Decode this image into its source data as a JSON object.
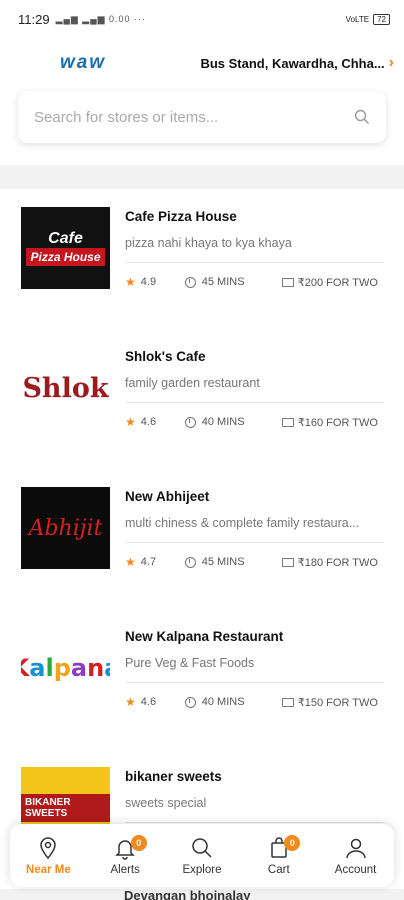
{
  "status_bar": {
    "time": "11:29",
    "signal": "0.00",
    "network": "VoLTE",
    "battery": "72"
  },
  "header": {
    "logo": "waw",
    "location": "Bus Stand, Kawardha, Chha..."
  },
  "search": {
    "placeholder": "Search for stores or items..."
  },
  "stores": [
    {
      "name": "Cafe Pizza House",
      "description": "pizza nahi khaya to kya khaya",
      "rating": "4.9",
      "time": "45 MINS",
      "cost": "₹200 FOR TWO",
      "logo_text_1": "Cafe",
      "logo_text_2": "Pizza House"
    },
    {
      "name": "Shlok's Cafe",
      "description": "family garden restaurant",
      "rating": "4.6",
      "time": "40 MINS",
      "cost": "₹160 FOR TWO",
      "logo_text_1": "Shlok",
      "logo_text_2": ""
    },
    {
      "name": "New Abhijeet",
      "description": "multi chiness & complete family restaura...",
      "rating": "4.7",
      "time": "45 MINS",
      "cost": "₹180 FOR TWO",
      "logo_text_1": "Abhijit",
      "logo_text_2": ""
    },
    {
      "name": "New Kalpana Restaurant",
      "description": "Pure Veg & Fast Foods",
      "rating": "4.6",
      "time": "40 MINS",
      "cost": "₹150 FOR TWO",
      "logo_text_1": "Kalpana",
      "logo_text_2": ""
    },
    {
      "name": "bikaner sweets",
      "description": "sweets special",
      "rating": "",
      "time": "",
      "cost": "",
      "logo_text_1": "BIKANER SWEETS",
      "logo_text_2": ""
    }
  ],
  "peek_name": "Devangan bhojnalay",
  "bottom_nav": [
    {
      "label": "Near Me",
      "icon": "location-pin-icon",
      "active": true
    },
    {
      "label": "Alerts",
      "icon": "bell-icon",
      "badge": "0"
    },
    {
      "label": "Explore",
      "icon": "search-icon"
    },
    {
      "label": "Cart",
      "icon": "cart-icon",
      "badge": "0"
    },
    {
      "label": "Account",
      "icon": "user-icon"
    }
  ],
  "colors": {
    "accent": "#f08a1c",
    "brand_blue": "#1a6fb0"
  }
}
